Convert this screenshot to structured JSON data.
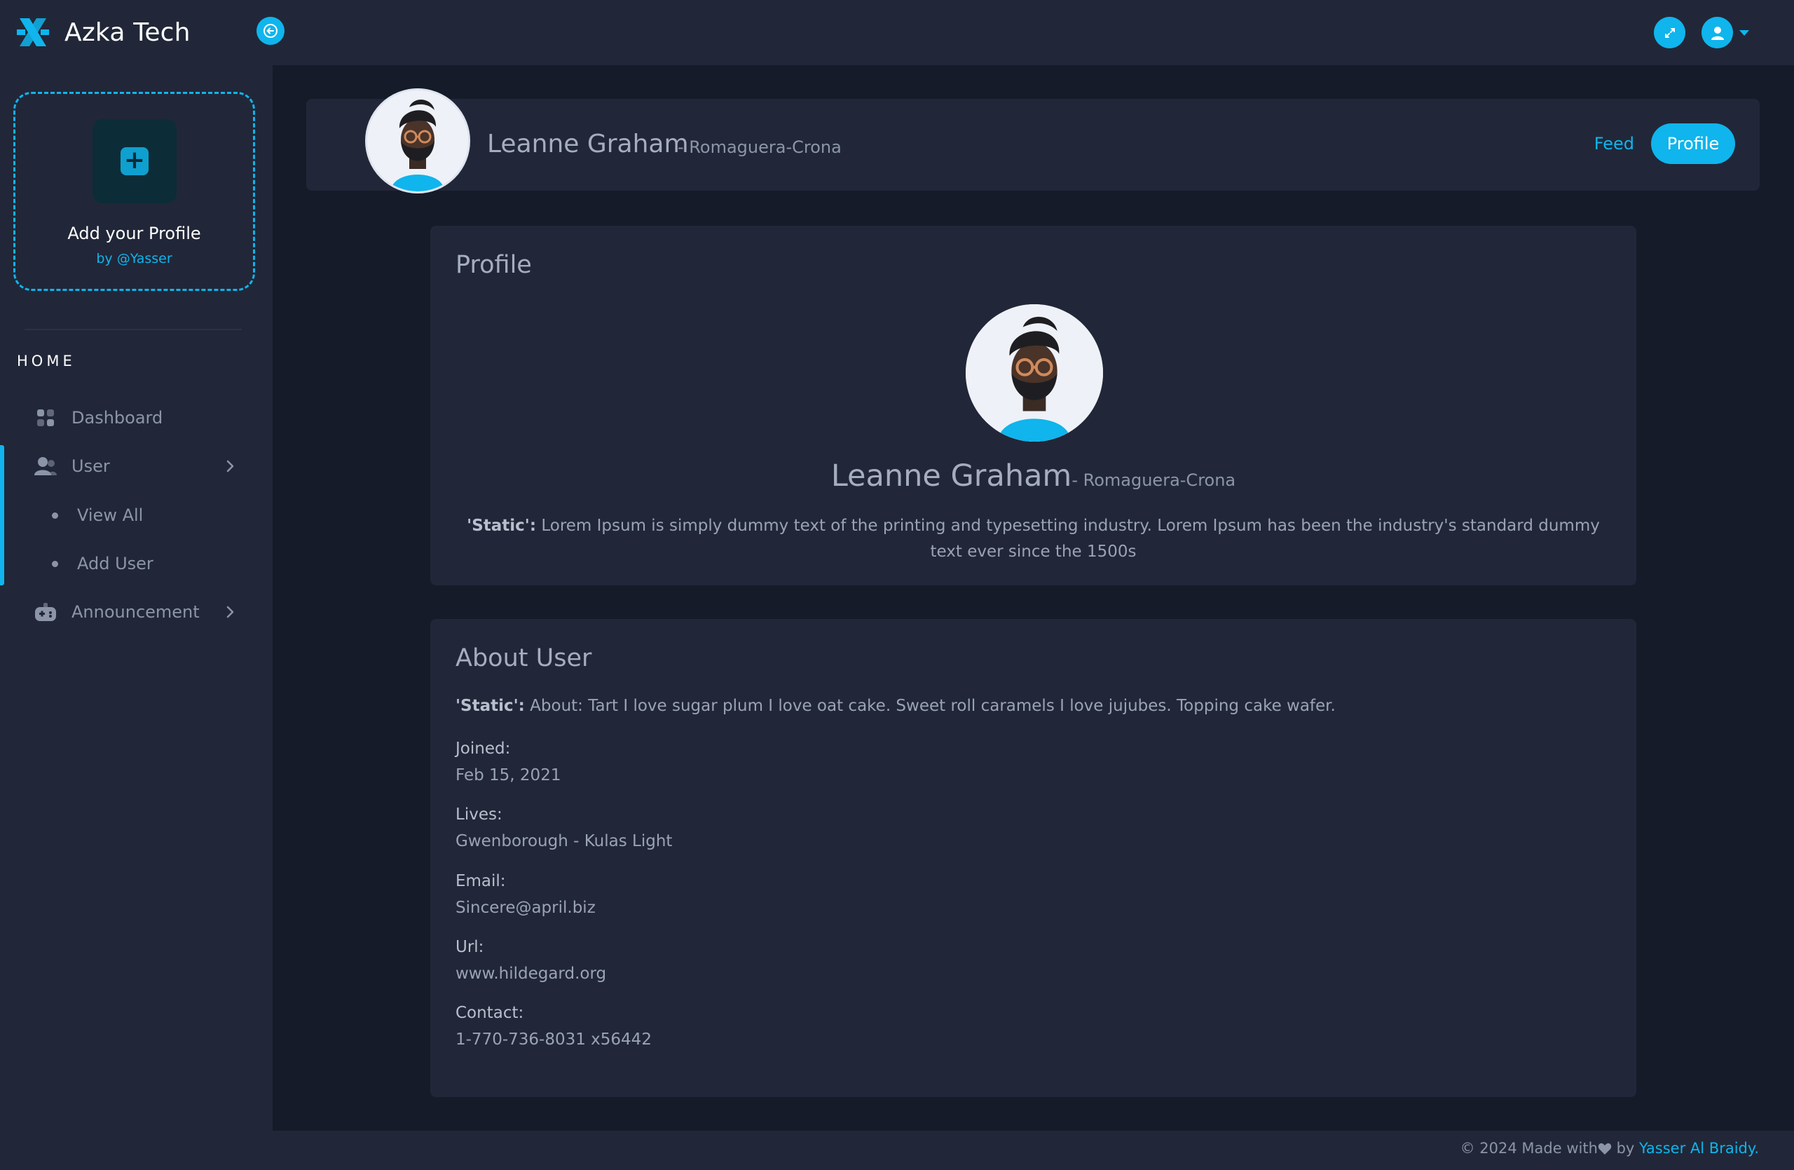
{
  "brand": {
    "name": "Azka Tech"
  },
  "sidebar": {
    "add_profile": {
      "title": "Add your Profile",
      "subtitle": "by @Yasser"
    },
    "section_title": "HOME",
    "items": [
      {
        "label": "Dashboard",
        "icon": "dashboard-grid-icon"
      },
      {
        "label": "User",
        "icon": "users-icon",
        "expanded": true,
        "children": [
          {
            "label": "View All"
          },
          {
            "label": "Add User"
          }
        ]
      },
      {
        "label": "Announcement",
        "icon": "gamepad-icon"
      }
    ]
  },
  "header": {
    "name": "Leanne Graham",
    "company": "- Romaguera-Crona",
    "tabs": {
      "feed": "Feed",
      "profile": "Profile"
    }
  },
  "profile": {
    "title": "Profile",
    "name": "Leanne Graham",
    "company": "- Romaguera-Crona",
    "bio_tag": "'Static':",
    "bio": " Lorem Ipsum is simply dummy text of the printing and typesetting industry. Lorem Ipsum has been the industry's standard dummy text ever since the 1500s"
  },
  "about": {
    "title": "About User",
    "about_tag": "'Static':",
    "about_text": " About: Tart I love sugar plum I love oat cake. Sweet roll caramels I love jujubes. Topping cake wafer.",
    "fields": [
      {
        "label": "Joined:",
        "value": "Feb 15, 2021"
      },
      {
        "label": "Lives:",
        "value": "Gwenborough - Kulas Light"
      },
      {
        "label": "Email:",
        "value": "Sincere@april.biz"
      },
      {
        "label": "Url:",
        "value": "www.hildegard.org"
      },
      {
        "label": "Contact:",
        "value": "1-770-736-8031 x56442"
      }
    ]
  },
  "footer": {
    "prefix": "© 2024 Made with",
    "by": " by ",
    "author": "Yasser Al Braidy",
    "suffix": "."
  },
  "colors": {
    "accent": "#0fb5ec",
    "panel": "#212738",
    "background": "#161b29"
  }
}
